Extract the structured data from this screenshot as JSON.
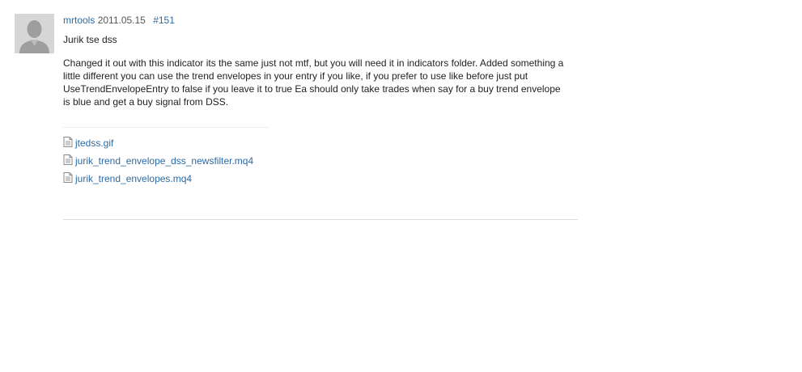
{
  "post": {
    "author": "mrtools",
    "date": "2011.05.15",
    "number": "#151",
    "title": "Jurik tse dss",
    "body": "Changed it out with this indicator its the same just not mtf, but you will need it in indicators folder. Added something a little different you can use the trend envelopes in your entry if you like, if you prefer to use like before just put UseTrendEnvelopeEntry to false if you leave it to true Ea should only take trades when say for a buy trend envelope is blue and get a buy signal from DSS.",
    "attachments": [
      {
        "name": "jtedss.gif",
        "icon": "file-icon"
      },
      {
        "name": "jurik_trend_envelope_dss_newsfilter.mq4",
        "icon": "file-icon"
      },
      {
        "name": "jurik_trend_envelopes.mq4",
        "icon": "file-icon"
      }
    ]
  },
  "colors": {
    "link": "#2b6aa5",
    "text": "#222222",
    "avatar_bg": "#d6d6d6",
    "avatar_fg": "#9e9e9e"
  }
}
